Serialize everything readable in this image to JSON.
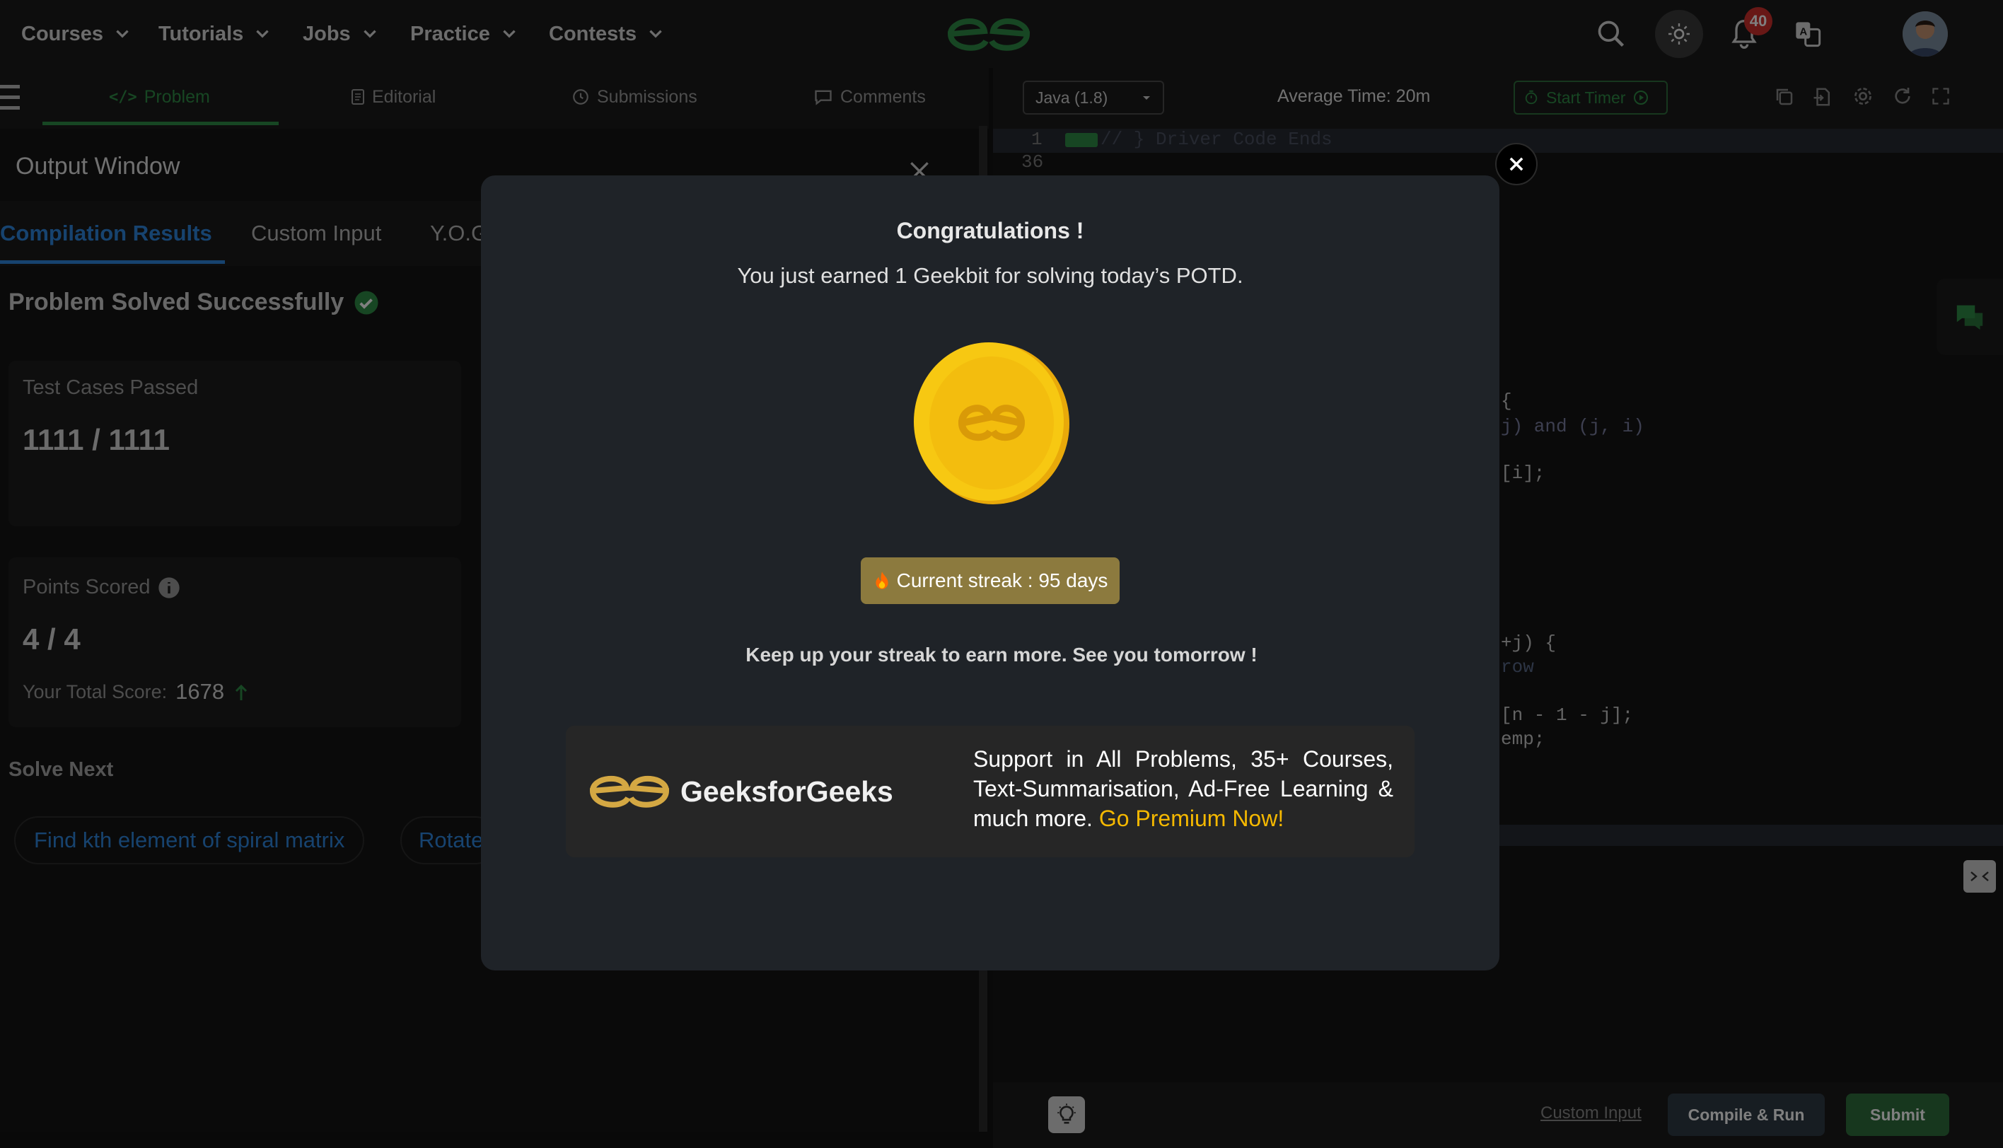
{
  "nav": {
    "items": [
      {
        "label": "Courses"
      },
      {
        "label": "Tutorials"
      },
      {
        "label": "Jobs"
      },
      {
        "label": "Practice"
      },
      {
        "label": "Contests"
      }
    ],
    "notification_count": "40",
    "colors": {
      "brand": "#2f8d46",
      "badge": "#d0312d"
    }
  },
  "problem_tabs": {
    "problem": "Problem",
    "editorial": "Editorial",
    "submissions": "Submissions",
    "comments": "Comments"
  },
  "editor_bar": {
    "language": "Java (1.8)",
    "average_time": "Average Time: 20m",
    "start_timer": "Start Timer"
  },
  "output": {
    "title": "Output Window",
    "tabs": [
      "Compilation Results",
      "Custom Input",
      "Y.O.G"
    ],
    "status": "Problem Solved Successfully",
    "test_cases_label": "Test Cases Passed",
    "test_cases_value": "1111 / 1111",
    "points_label": "Points Scored",
    "points_value": "4 / 4",
    "total_score_label": "Your Total Score:",
    "total_score_value": "1678",
    "solve_next_label": "Solve Next",
    "solve_next": [
      "Find kth element of spiral matrix",
      "Rotate"
    ]
  },
  "editor": {
    "lines": [
      {
        "num": "1",
        "text": "// } Driver Code Ends"
      },
      {
        "num": "36",
        "text": ""
      }
    ],
    "visible_fragments": [
      "{",
      "j) and (j, i)",
      "[i];",
      "+j) {",
      "row",
      "[n - 1 - j];",
      "emp;"
    ]
  },
  "modal": {
    "title": "Congratulations !",
    "subtitle": "You just earned 1 Geekbit for solving today’s POTD.",
    "streak": "Current streak : 95 days",
    "message": "Keep up your streak to earn more. See you tomorrow !",
    "brand_name": "GeeksforGeeks",
    "premium_text": "Support in All Problems, 35+ Courses, Text-Summarisation, Ad-Free Learning & much more.",
    "premium_link": "Go Premium Now!",
    "colors": {
      "coin": "#f3c20f",
      "streak_bg": "#8c7a3e",
      "link": "#f5b800"
    }
  },
  "bottom": {
    "custom_input": "Custom Input",
    "compile_run": "Compile & Run",
    "submit": "Submit"
  }
}
